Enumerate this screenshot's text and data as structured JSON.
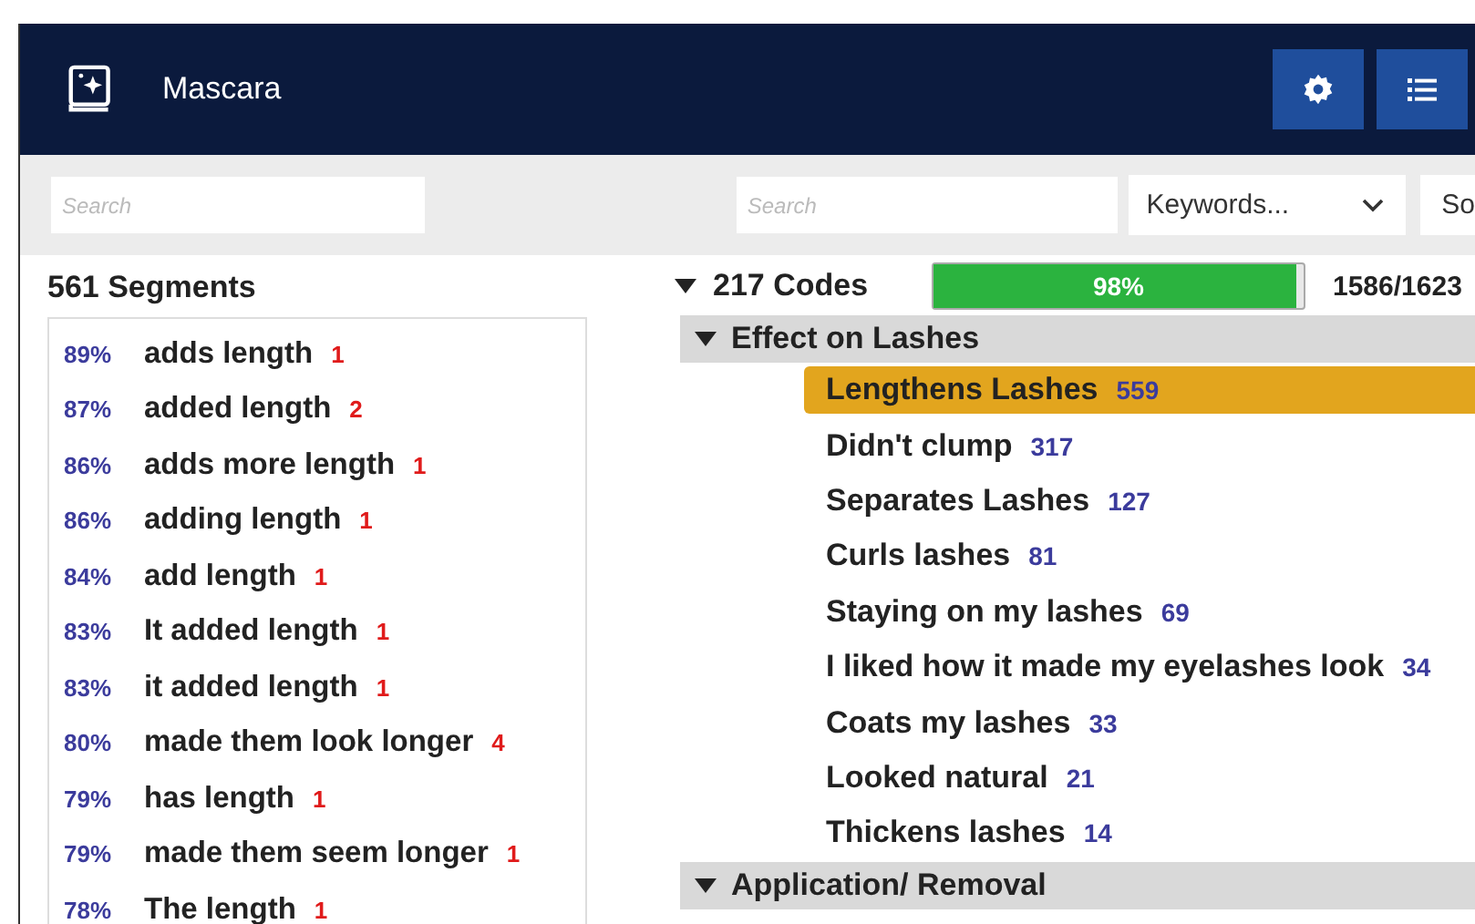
{
  "window": {
    "title": "Mascara"
  },
  "toolbar": {
    "search_left": {
      "placeholder": "Search"
    },
    "search_right": {
      "placeholder": "Search"
    },
    "dropdown": {
      "value": "Keywords..."
    },
    "cut_control": {
      "value": "So"
    }
  },
  "segments": {
    "title": "561 Segments",
    "items": [
      {
        "score": "89%",
        "text": "adds length",
        "count": "1"
      },
      {
        "score": "87%",
        "text": "added length",
        "count": "2"
      },
      {
        "score": "86%",
        "text": "adds more length",
        "count": "1"
      },
      {
        "score": "86%",
        "text": "adding length",
        "count": "1"
      },
      {
        "score": "84%",
        "text": "add length",
        "count": "1"
      },
      {
        "score": "83%",
        "text": "It added length",
        "count": "1"
      },
      {
        "score": "83%",
        "text": "it added length",
        "count": "1"
      },
      {
        "score": "80%",
        "text": "made them look longer",
        "count": "4"
      },
      {
        "score": "79%",
        "text": "has length",
        "count": "1"
      },
      {
        "score": "79%",
        "text": "made them seem longer",
        "count": "1"
      },
      {
        "score": "78%",
        "text": "The length",
        "count": "1"
      }
    ]
  },
  "codes": {
    "title": "217 Codes",
    "expanded": true,
    "progress": {
      "level": 0.98,
      "label": "98%"
    },
    "ratio": "1586/1623",
    "categories": [
      {
        "label": "Effect on Lashes",
        "expanded": true,
        "children": [
          {
            "label": "Lengthens Lashes",
            "count": "559",
            "selected": true
          },
          {
            "label": "Didn't clump",
            "count": "317",
            "selected": false
          },
          {
            "label": "Separates Lashes",
            "count": "127",
            "selected": false
          },
          {
            "label": "Curls lashes",
            "count": "81",
            "selected": false
          },
          {
            "label": "Staying on my lashes",
            "count": "69",
            "selected": false
          },
          {
            "label": "I liked how it made my eyelashes look",
            "count": "34",
            "selected": false
          },
          {
            "label": "Coats my lashes",
            "count": "33",
            "selected": false
          },
          {
            "label": "Looked natural",
            "count": "21",
            "selected": false
          },
          {
            "label": "Thickens lashes",
            "count": "14",
            "selected": false
          }
        ]
      },
      {
        "label": "Application/ Removal",
        "expanded": true
      }
    ]
  }
}
